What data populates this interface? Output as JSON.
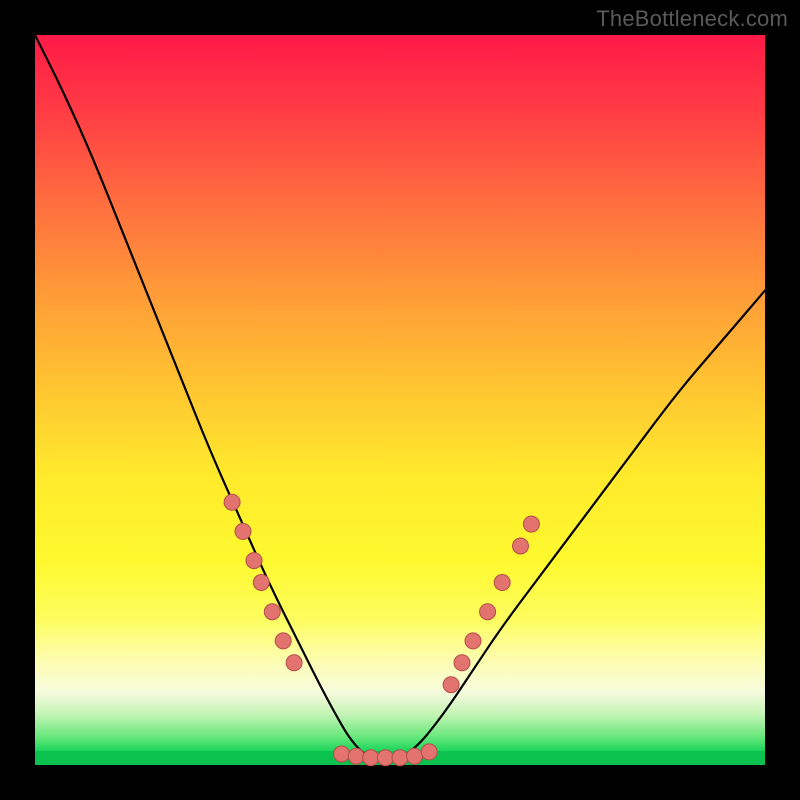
{
  "watermark": "TheBottleneck.com",
  "colors": {
    "background": "#000000",
    "gradient_top": "#ff1a47",
    "gradient_bottom": "#0cc24f",
    "curve": "#000000",
    "dot_fill": "#e2736f",
    "dot_stroke": "#b24d49"
  },
  "chart_data": {
    "type": "line",
    "title": "",
    "xlabel": "",
    "ylabel": "",
    "xlim": [
      0,
      100
    ],
    "ylim": [
      0,
      100
    ],
    "notes": "V-shaped bottleneck curve on vertical heat gradient (red=high bottleneck, green=low). Minimum sits on the green floor around x≈44–52. Pink markers cluster on both flanks and along the flat bottom.",
    "series": [
      {
        "name": "bottleneck-curve",
        "x": [
          0,
          4,
          8,
          12,
          16,
          20,
          24,
          28,
          32,
          36,
          40,
          44,
          48,
          52,
          56,
          60,
          64,
          70,
          76,
          82,
          88,
          94,
          100
        ],
        "y": [
          100,
          92,
          83,
          73,
          63,
          53,
          43,
          34,
          25,
          17,
          9,
          2,
          0,
          2,
          7,
          13,
          19,
          27,
          35,
          43,
          51,
          58,
          65
        ]
      }
    ],
    "markers": [
      {
        "x": 27,
        "y": 36
      },
      {
        "x": 28.5,
        "y": 32
      },
      {
        "x": 30,
        "y": 28
      },
      {
        "x": 31,
        "y": 25
      },
      {
        "x": 32.5,
        "y": 21
      },
      {
        "x": 34,
        "y": 17
      },
      {
        "x": 35.5,
        "y": 14
      },
      {
        "x": 42,
        "y": 1.5
      },
      {
        "x": 44,
        "y": 1.2
      },
      {
        "x": 46,
        "y": 1.0
      },
      {
        "x": 48,
        "y": 1.0
      },
      {
        "x": 50,
        "y": 1.0
      },
      {
        "x": 52,
        "y": 1.2
      },
      {
        "x": 54,
        "y": 1.8
      },
      {
        "x": 57,
        "y": 11
      },
      {
        "x": 58.5,
        "y": 14
      },
      {
        "x": 60,
        "y": 17
      },
      {
        "x": 62,
        "y": 21
      },
      {
        "x": 64,
        "y": 25
      },
      {
        "x": 66.5,
        "y": 30
      },
      {
        "x": 68,
        "y": 33
      }
    ]
  }
}
